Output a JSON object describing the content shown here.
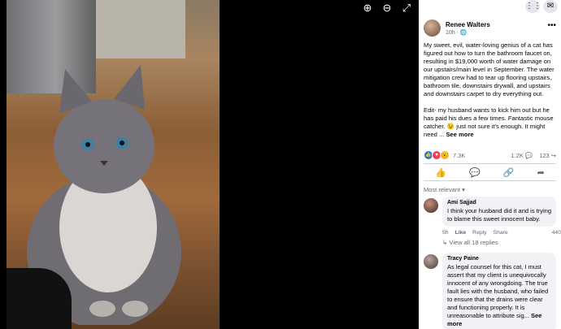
{
  "viewer": {
    "zoom_in_icon": "zoom-in-icon",
    "zoom_out_icon": "zoom-out-icon",
    "expand_icon": "expand-icon"
  },
  "topbar": {
    "icons": [
      "grid-icon",
      "messenger-icon"
    ]
  },
  "post": {
    "author": "Renee Walters",
    "time": "10h · ",
    "paragraph1": "My sweet, evil, water-loving genius of a cat has figured out how to turn the bathroom faucet on, resulting in $19,000 worth of water damage on our upstairs/main level in September. The water mitigation crew had to tear up flooring upstairs, bathroom tile, downstairs drywall, and upstairs and downstairs carpet to dry everything out.",
    "paragraph2": "Edit- my husband wants to kick him out but he has paid his dues a few times. Fantastic mouse catcher. 😉 just not sure it's enough. It might need ... ",
    "see_more": "See more",
    "reactions_count": "7.3K",
    "comments_count": "1.2K",
    "shares_count": "123"
  },
  "sort_label": "Most relevant",
  "comments": [
    {
      "name": "Ami Sajjad",
      "text": "I think your husband did it and is trying to blame this sweet innocent baby.",
      "time": "5h",
      "like": "Like",
      "reply": "Reply",
      "share": "Share",
      "reaction_count": "440",
      "replies": "View all 18 replies"
    },
    {
      "name": "Tracy Paine",
      "text": "As legal counsel for this cat, I must assert that my client is unequivocally innocent of any wrongdoing. The true fault lies with the husband, who failed to ensure that the drains were clear and functioning properly. It is unreasonable to attribute sig... ",
      "see_more": "See more"
    }
  ],
  "colors": {
    "like_blue": "#1877f2",
    "love_red": "#f33e58",
    "wow_yellow": "#f7b125"
  }
}
